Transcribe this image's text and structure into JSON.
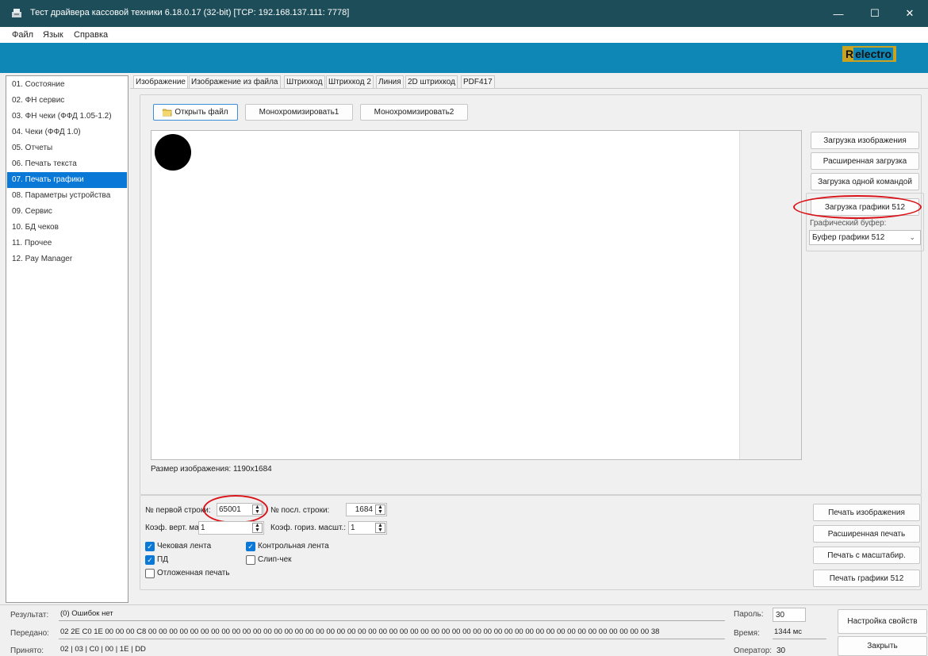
{
  "window": {
    "title": "Тест драйвера кассовой техники 6.18.0.17 (32-bit) [TCP: 192.168.137.111: 7778]",
    "minimize": "—",
    "maximize": "☐",
    "close": "✕"
  },
  "menu": [
    "Файл",
    "Язык",
    "Справка"
  ],
  "brand": {
    "r": "R",
    "rest": "electro",
    "color": "#c8a220"
  },
  "sidebar": {
    "items": [
      "01. Состояние",
      "02. ФН сервис",
      "03. ФН чеки (ФФД 1.05-1.2)",
      "04. Чеки (ФФД 1.0)",
      "05. Отчеты",
      "06. Печать текста",
      "07. Печать графики",
      "08. Параметры устройства",
      "09. Сервис",
      "10. БД чеков",
      "11. Прочее",
      "12. Pay Manager"
    ],
    "selected_index": 6
  },
  "tabs": [
    "Изображение",
    "Изображение из файла",
    "Штрихкод",
    "Штрихкод 2",
    "Линия",
    "2D штрихкод",
    "PDF417"
  ],
  "toolbar": {
    "open_file": "Открыть файл",
    "mono1": "Монохромизировать1",
    "mono2": "Монохромизировать2"
  },
  "right_buttons": {
    "load_image": "Загрузка изображения",
    "extended_load": "Расширенная загрузка",
    "load_one_command": "Загрузка одной командой",
    "load_graphics_512": "Загрузка графики 512",
    "buffer_label": "Графический буфер:",
    "buffer_value": "Буфер графики 512"
  },
  "image_size": "Размер изображения:  1190x1684",
  "params": {
    "first_line_label": "№ первой строки:",
    "first_line_value": "65001",
    "last_line_label": "№ посл. строки:",
    "last_line_value": "1684",
    "vscale_label": "Коэф. верт. масшт.:",
    "vscale_value": "1",
    "hscale_label": "Коэф. гориз. масшт.:",
    "hscale_value": "1"
  },
  "checkboxes": {
    "receipt_tape": {
      "label": "Чековая лента",
      "checked": true
    },
    "control_tape": {
      "label": "Контрольная лента",
      "checked": true
    },
    "pd": {
      "label": "ПД",
      "checked": true
    },
    "slip": {
      "label": "Слип-чек",
      "checked": false
    },
    "deferred": {
      "label": "Отложенная печать",
      "checked": false
    }
  },
  "print_buttons": {
    "print_image": "Печать изображения",
    "extended_print": "Расширенная печать",
    "scaled_print": "Печать с масштабир.",
    "print_graphics_512": "Печать графики 512"
  },
  "status": {
    "result_label": "Результат:",
    "result_value": "(0) Ошибок нет",
    "sent_label": "Передано:",
    "sent_value": "02 2E C0 1E 00 00 00 C8 00 00 00 00 00 00 00 00 00 00 00 00 00 00 00 00 00 00 00 00 00 00 00 00 00 00 00 00 00 00 00 00 00 00 00 00 00 00 00 00 00 00 00 00 00 00 00 00 38",
    "received_label": "Принято:",
    "received_value": "02 | 03 | C0 | 00 | 1E | DD",
    "password_label": "Пароль:",
    "password_value": "30",
    "time_label": "Время:",
    "time_value": "1344 мс",
    "operator_label": "Оператор:",
    "operator_value": "30",
    "settings": "Настройка свойств",
    "close": "Закрыть"
  },
  "colors": {
    "accent": "#0a78d7",
    "brand_band": "#0e87b7",
    "titlebar": "#1e4d5a",
    "highlight_ring": "#d9141a"
  }
}
